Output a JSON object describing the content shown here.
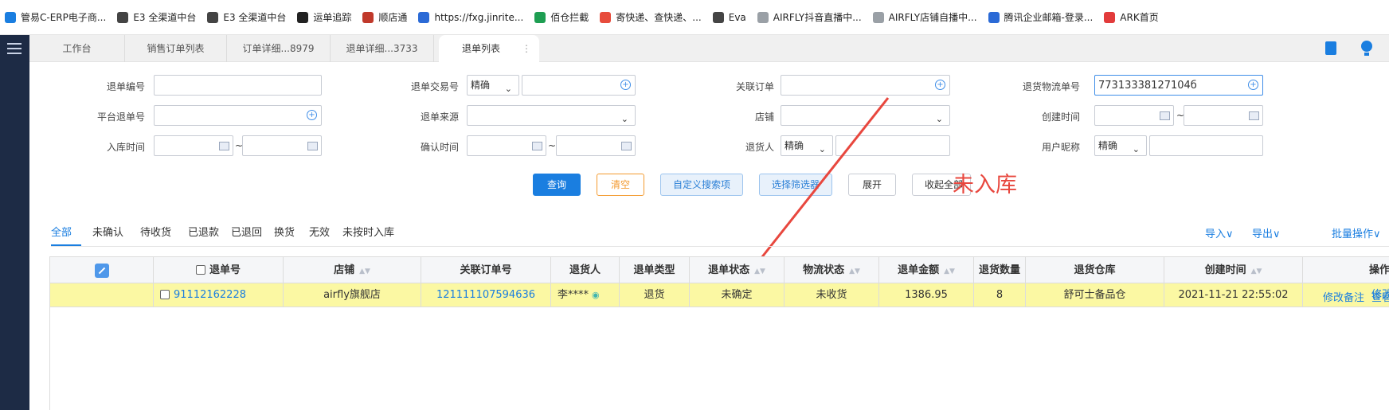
{
  "bookmarks": [
    {
      "label": "管易C-ERP电子商...",
      "icon": "g-logo-icon",
      "color": "#1a7ee0"
    },
    {
      "label": "E3 全渠道中台",
      "icon": "globe-icon",
      "color": "#444444"
    },
    {
      "label": "E3 全渠道中台",
      "icon": "globe-icon",
      "color": "#444444"
    },
    {
      "label": "运单追踪",
      "icon": "sf-logo-icon",
      "color": "#222222"
    },
    {
      "label": "顺店通",
      "icon": "house-icon",
      "color": "#c0392b"
    },
    {
      "label": "https://fxg.jinrite...",
      "icon": "fxg-logo-icon",
      "color": "#2b6ad6"
    },
    {
      "label": "佰仓拦截",
      "icon": "sheet-icon",
      "color": "#1e9e52"
    },
    {
      "label": "寄快递、查快递、...",
      "icon": "kuaidi-logo-icon",
      "color": "#e74c3c"
    },
    {
      "label": "Eva",
      "icon": "globe-icon",
      "color": "#444444"
    },
    {
      "label": "AIRFLY抖音直播中...",
      "icon": "doc-icon",
      "color": "#9aa0a6"
    },
    {
      "label": "AIRFLY店铺自播中...",
      "icon": "doc-icon",
      "color": "#9aa0a6"
    },
    {
      "label": "腾讯企业邮箱-登录...",
      "icon": "mail-icon",
      "color": "#2b6ad6"
    },
    {
      "label": "ARK首页",
      "icon": "ark-logo-icon",
      "color": "#e23b3b"
    }
  ],
  "tabs": [
    "工作台",
    "销售订单列表",
    "订单详细...8979",
    "退单详细...3733",
    "退单列表"
  ],
  "tab_more": "⋮",
  "form": {
    "row1": {
      "refund_no_label": "退单编号",
      "trade_no_label": "退单交易号",
      "trade_no_mode": "精确",
      "related_order_label": "关联订单",
      "logistics_no_label": "退货物流单号",
      "logistics_no_value": "77313338127104б"
    },
    "row2": {
      "platform_no_label": "平台退单号",
      "source_label": "退单来源",
      "shop_label": "店铺",
      "created_time_label": "创建时间"
    },
    "row3": {
      "instock_time_label": "入库时间",
      "confirm_time_label": "确认时间",
      "returner_label": "退货人",
      "returner_mode": "精确",
      "nickname_label": "用户昵称",
      "nickname_mode": "精确"
    },
    "tilde": "~"
  },
  "buttons": {
    "query": "查询",
    "clear": "清空",
    "custom_search": "自定义搜索项",
    "select_filter": "选择筛选器",
    "expand": "展开",
    "collapse_all": "收起全部"
  },
  "annotation": "未入库",
  "status_tabs": [
    "全部",
    "未确认",
    "待收货",
    "已退款",
    "已退回",
    "换货",
    "无效",
    "未按时入库"
  ],
  "actions": {
    "import": "导入∨",
    "export": "导出∨",
    "batch": "批量操作∨"
  },
  "table": {
    "headers": [
      "退单号",
      "店铺",
      "关联订单号",
      "退货人",
      "退单类型",
      "退单状态",
      "物流状态",
      "退单金额",
      "退货数量",
      "退货仓库",
      "创建时间",
      "操作"
    ],
    "rows": [
      {
        "refund_no": "91112162228",
        "shop": "airfly旗舰店",
        "related_order": "121111107594636",
        "returner": "李****",
        "type": "退货",
        "status": "未确定",
        "logistics_status": "未收货",
        "amount": "1386.95",
        "qty": "8",
        "warehouse": "舒可士备品仓",
        "created": "2021-11-21 22:55:02",
        "op_edit_note": "修改备注",
        "op_view": "查看"
      }
    ]
  },
  "colors": {
    "accent": "#1a7ee0",
    "highlight_row": "#fbf8a3",
    "annotation": "#e8473e",
    "sidebar": "#1d2b45"
  }
}
